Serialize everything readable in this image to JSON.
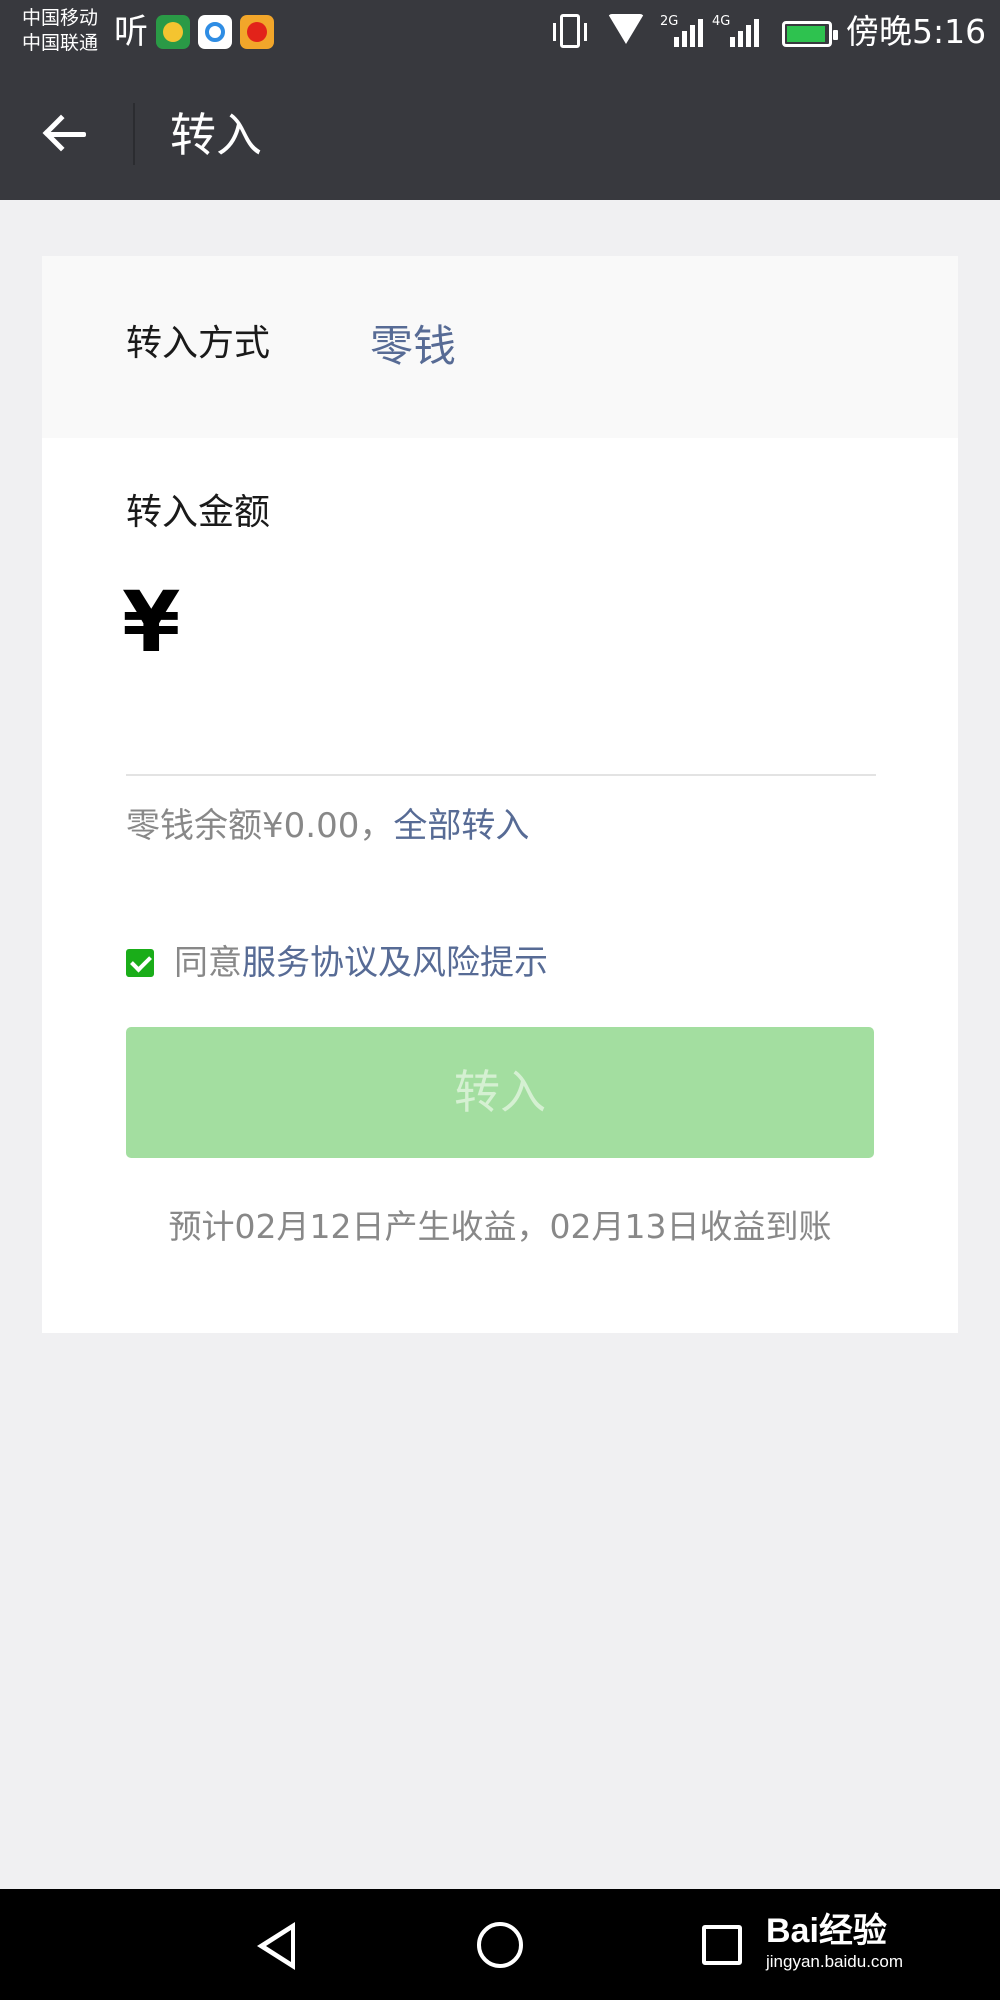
{
  "status_bar": {
    "carrier_1": "中国移动",
    "carrier_2": "中国联通",
    "ting_text": "听",
    "icons": [
      "vibrate-icon",
      "wifi-icon",
      "signal-icon",
      "battery-icon"
    ],
    "net_1": "2G",
    "net_2": "4G",
    "time": "傍晚5:16"
  },
  "app_bar": {
    "title": "转入",
    "back_icon": "arrow-left-icon"
  },
  "form": {
    "method_label": "转入方式",
    "method_value": "零钱",
    "amount_label": "转入金额",
    "currency_symbol": "¥",
    "amount_value": "",
    "balance_text": "零钱余额¥0.00，",
    "transfer_all": "全部转入",
    "agree_prefix": "同意",
    "agree_link": "服务协议及风险提示",
    "agree_checked": true,
    "submit_label": "转入",
    "estimate_text": "预计02月12日产生收益，02月13日收益到账"
  },
  "nav_bar": {
    "icons": [
      "nav-back-icon",
      "nav-home-icon",
      "nav-recents-icon"
    ],
    "watermark_logo": "Bai经验",
    "watermark_url": "jingyan.baidu.com"
  },
  "colors": {
    "header_bg": "#38393e",
    "link": "#576b95",
    "button_disabled": "#a3dea0",
    "checkbox": "#1aad19"
  }
}
